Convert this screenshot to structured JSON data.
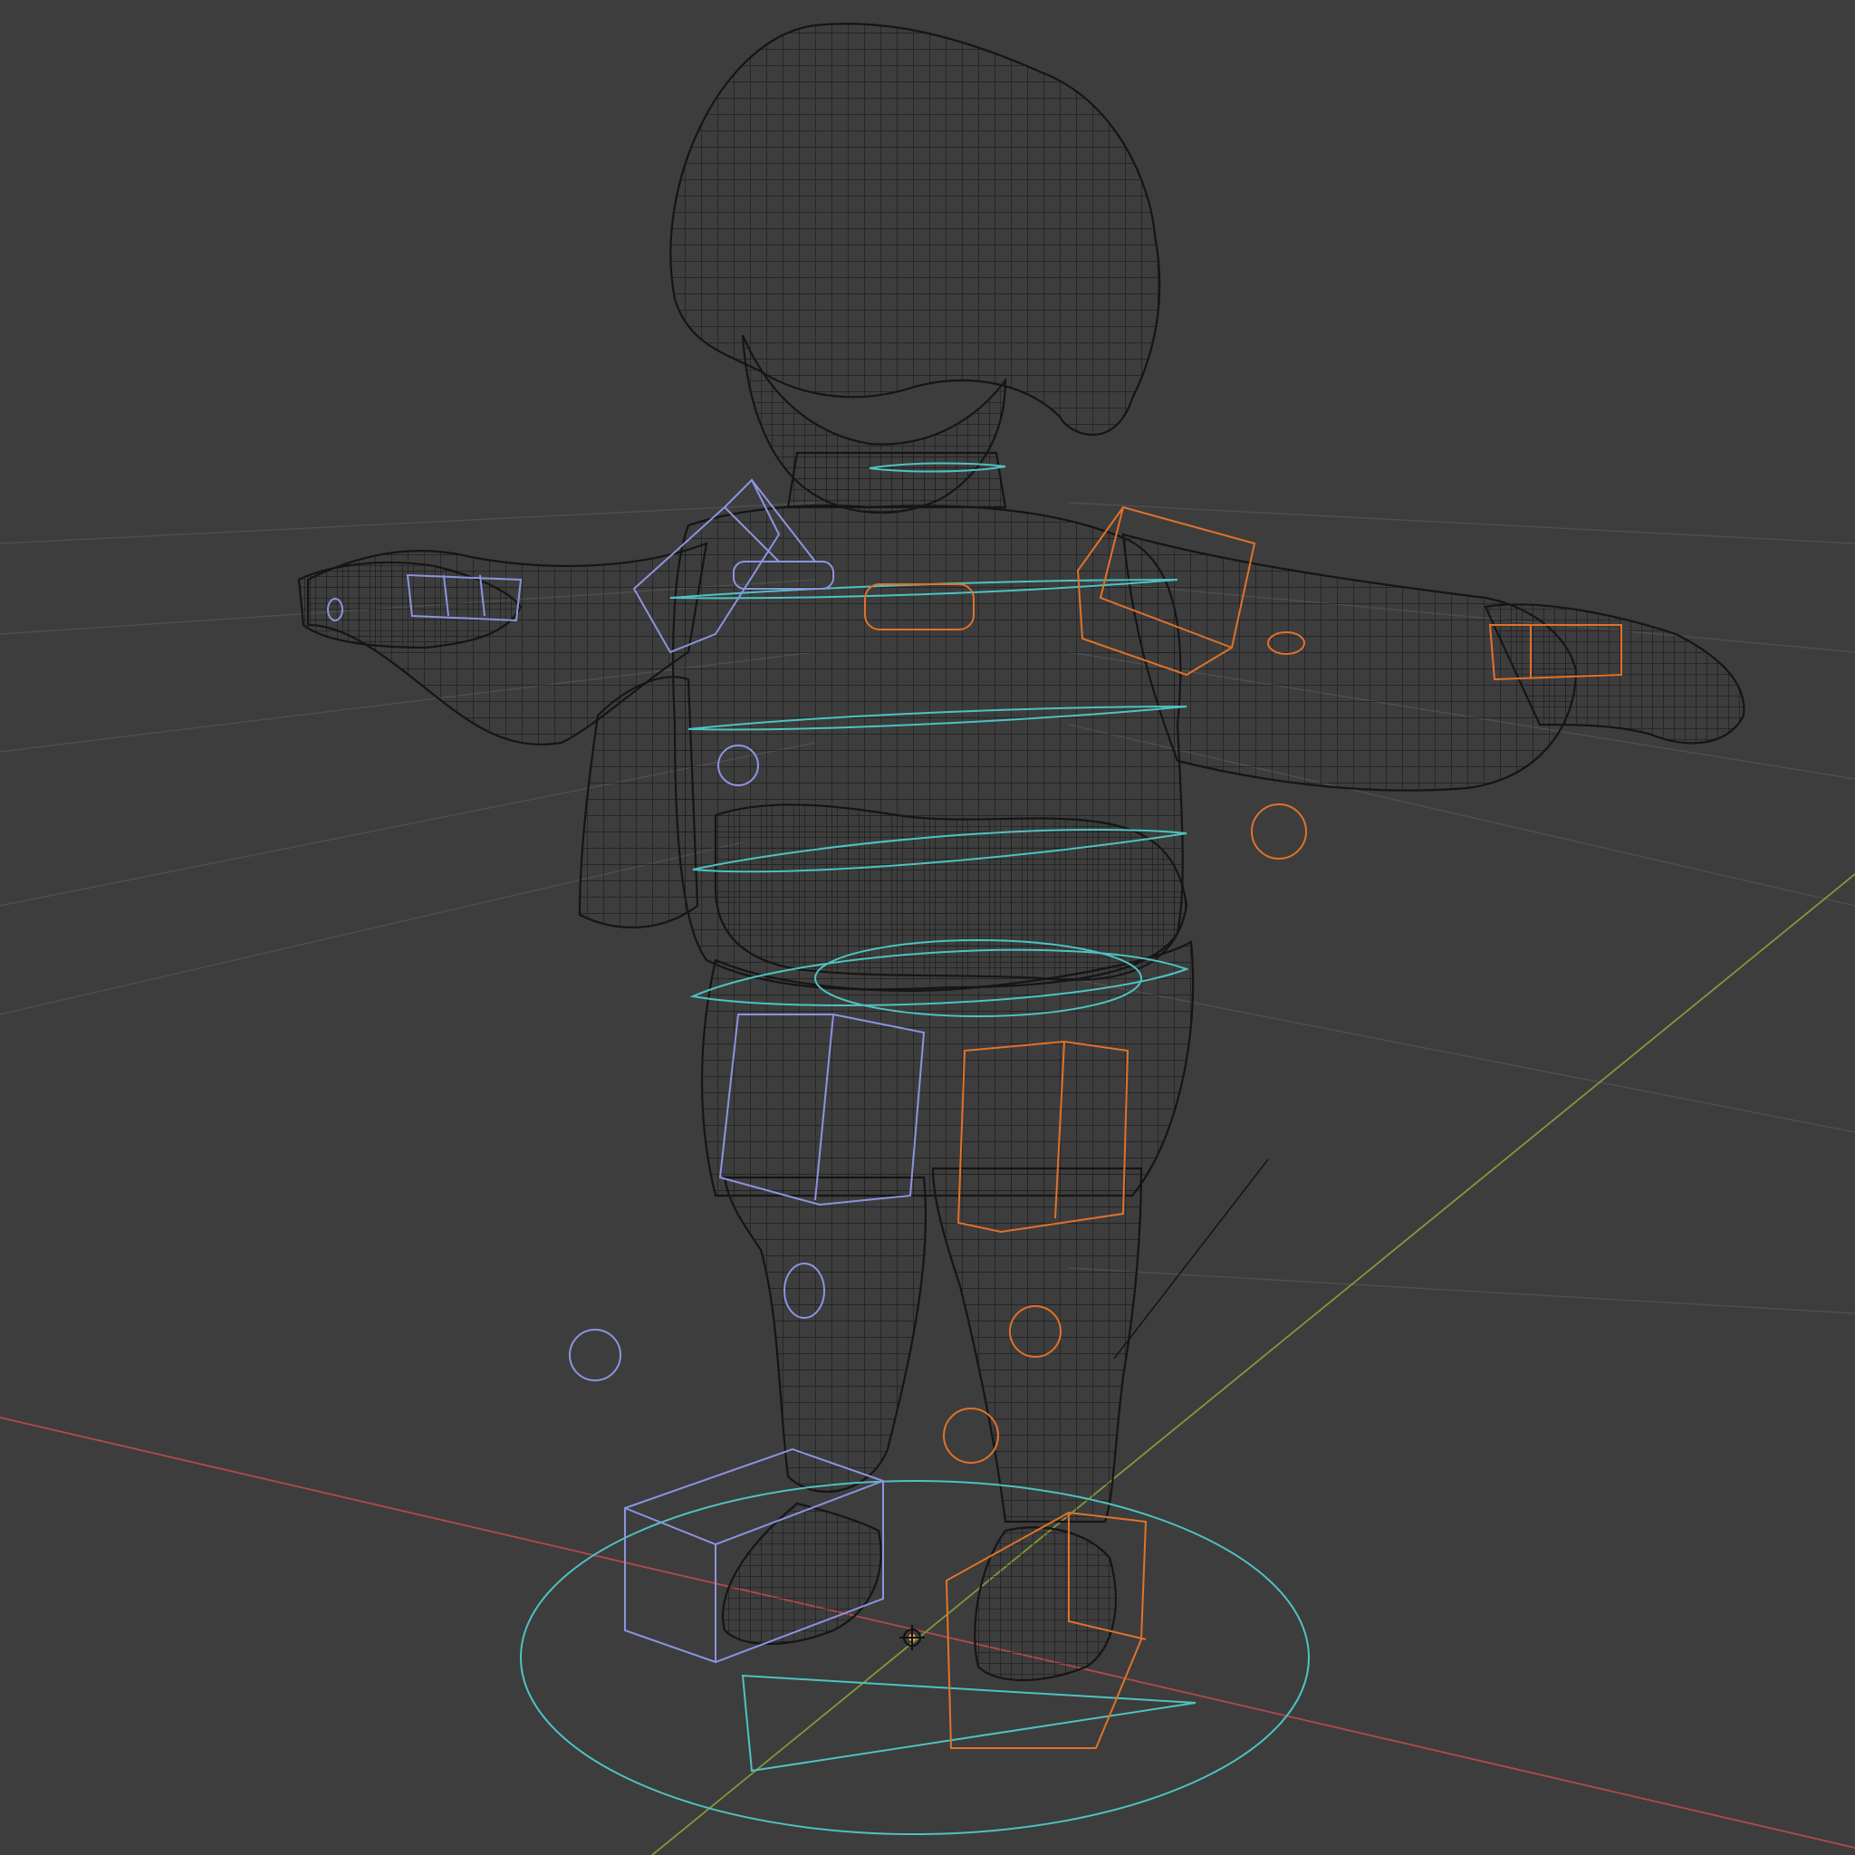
{
  "viewport": {
    "mode": "wireframe",
    "background": "#3d3d3d",
    "grid_color": "#4f4f4f",
    "axis_x_color": "#b24a4a",
    "axis_y_color": "#7f9a3a",
    "mesh_wire_color": "#1a1a1a",
    "center_controls_color": "#4fc2c2",
    "left_controls_color": "#8c94e0",
    "right_controls_color": "#e0722a",
    "origin_marker_color": "#e8a24a"
  },
  "scene": {
    "object": "character-mesh",
    "rig": "control-rig",
    "controls": {
      "center": [
        "neck-control",
        "chest-control-upper",
        "chest-control",
        "spine-control",
        "hips-control",
        "pelvis-control",
        "root-control"
      ],
      "left": [
        "left-shoulder-control",
        "left-hand-control",
        "left-elbow-pole",
        "left-knee-pole",
        "left-foot-ik-control",
        "left-thigh-fk-control",
        "left-leg-pole-target"
      ],
      "right": [
        "right-shoulder-control",
        "right-hand-control",
        "right-elbow-pole",
        "right-knee-pole",
        "right-foot-ik-control",
        "right-thigh-fk-control",
        "right-leg-pole-target"
      ]
    }
  }
}
